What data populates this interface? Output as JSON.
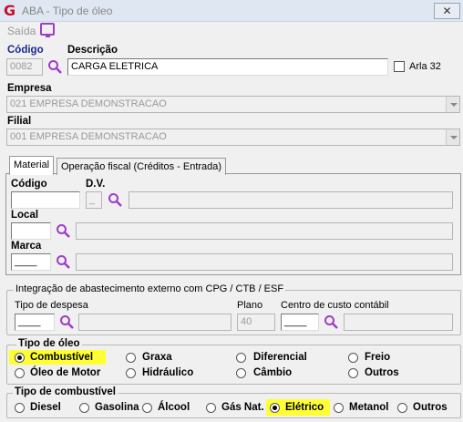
{
  "window": {
    "title": "ABA - Tipo de óleo",
    "close_glyph": "✕",
    "app_logo": "G"
  },
  "menu": {
    "saida": "Saída",
    "screen_icon": "monitor-icon"
  },
  "top": {
    "codigo_label": "Código",
    "codigo_value": "0082",
    "descricao_label": "Descrição",
    "descricao_value": "CARGA ELETRICA",
    "arla_label": "Arla 32",
    "arla_checked": false
  },
  "empresa": {
    "label": "Empresa",
    "value": "021 EMPRESA DEMONSTRACAO"
  },
  "filial": {
    "label": "Filial",
    "value": "001 EMPRESA DEMONSTRACAO"
  },
  "tabs": [
    {
      "label": "Material",
      "active": true
    },
    {
      "label": "Operação fiscal (Créditos - Entrada)",
      "active": false
    }
  ],
  "material": {
    "codigo_label": "Código",
    "dv_label": "D.V.",
    "dv_value": "_",
    "local_label": "Local",
    "marca_label": "Marca",
    "marca_value": "____"
  },
  "integracao": {
    "title": "Integração de abastecimento externo com CPG / CTB / ESF",
    "tipo_despesa_label": "Tipo de despesa",
    "tipo_despesa_value": "____",
    "plano_label": "Plano",
    "plano_value": "40",
    "centro_label": "Centro de custo contábil",
    "centro_value": "____"
  },
  "tipo_oleo": {
    "title": "Tipo de óleo",
    "selected": "Combustível",
    "options": [
      "Combustível",
      "Graxa",
      "Diferencial",
      "Freio",
      "Óleo de Motor",
      "Hidráulico",
      "Câmbio",
      "Outros"
    ]
  },
  "tipo_combustivel": {
    "title": "Tipo de combustível",
    "selected": "Elétrico",
    "options": [
      "Diesel",
      "Gasolina",
      "Álcool",
      "Gás Nat.",
      "Elétrico",
      "Metanol",
      "Outros"
    ]
  },
  "colors": {
    "highlight": "#ffff33",
    "search_icon": "#9b3fc7",
    "label_blue": "#1a2a8c"
  }
}
